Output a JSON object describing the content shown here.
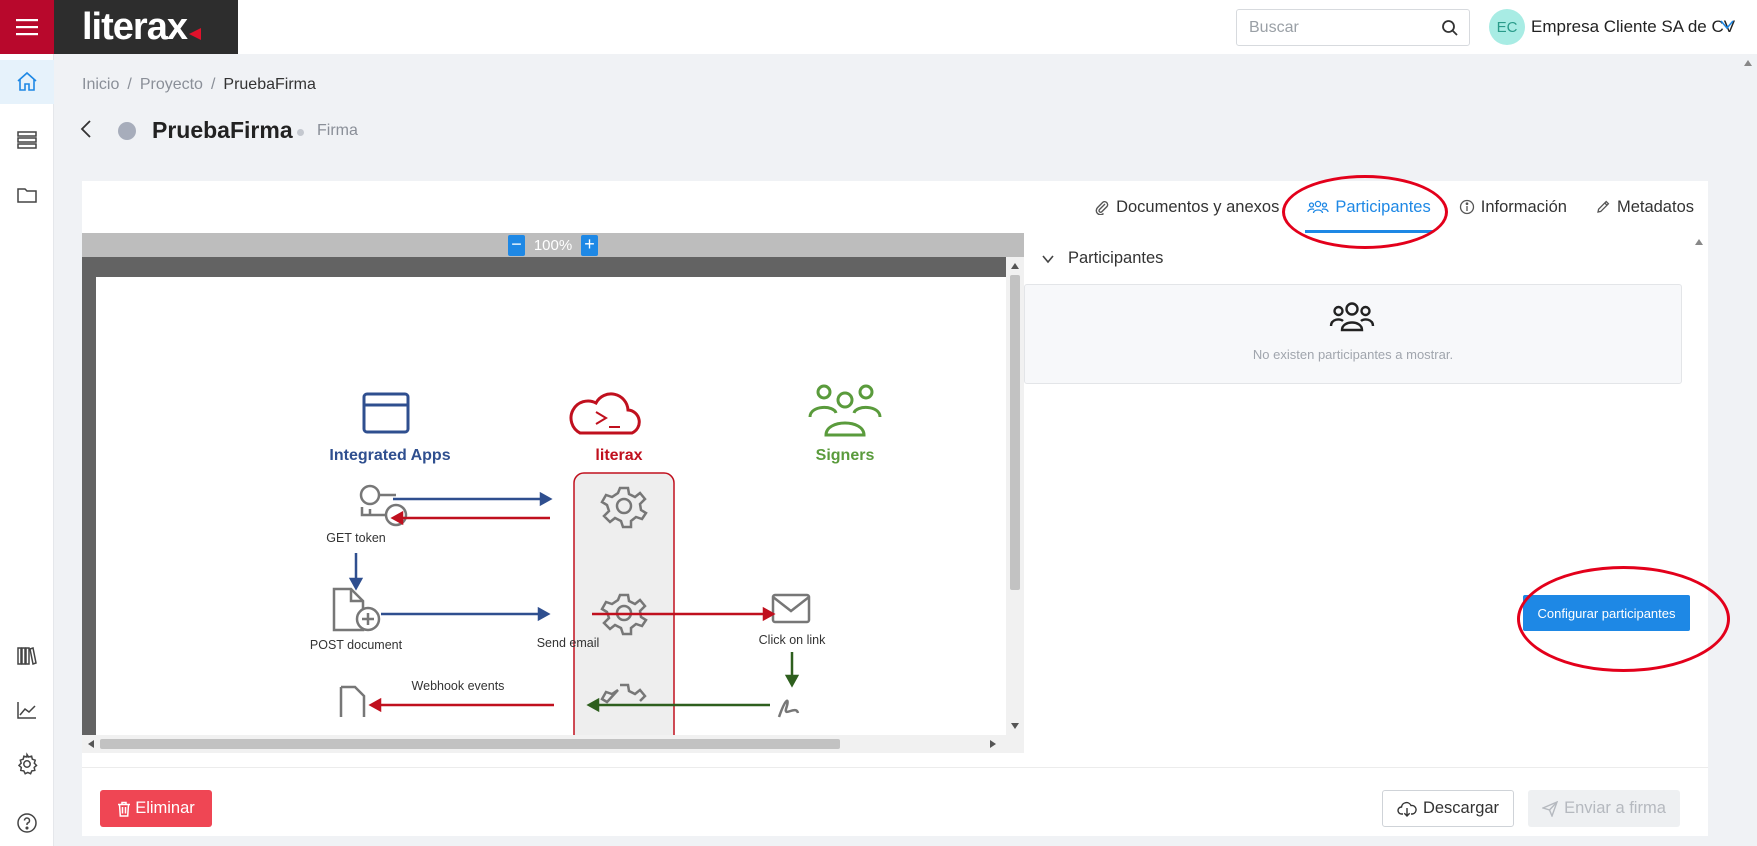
{
  "app": {
    "logo": "literax"
  },
  "header": {
    "search_placeholder": "Buscar",
    "user_initials": "EC",
    "user_name": "Empresa Cliente SA de CV"
  },
  "breadcrumb": {
    "items": [
      "Inicio",
      "Proyecto"
    ],
    "current": "PruebaFirma"
  },
  "title": {
    "name": "PruebaFirma",
    "type": "Firma"
  },
  "tabs": [
    "Documentos y anexos",
    "Participantes",
    "Información",
    "Metadatos"
  ],
  "active_tab": "Participantes",
  "viewer": {
    "zoom": "100%",
    "diagram": {
      "col_apps": "Integrated Apps",
      "col_literax": "literax",
      "col_signers": "Signers",
      "step_get_token": "GET token",
      "step_post_document": "POST document",
      "step_send_email": "Send email",
      "step_click_link": "Click on link",
      "step_webhook": "Webhook events"
    }
  },
  "participants": {
    "section_title": "Participantes",
    "empty_text": "No existen participantes a mostrar.",
    "config_button": "Configurar participantes"
  },
  "footer": {
    "delete_label": "Eliminar",
    "download_label": "Descargar",
    "send_label": "Enviar a firma"
  },
  "colors": {
    "brand_red": "#b8082c",
    "accent_blue": "#1e88e5",
    "danger": "#ef4654",
    "diagram_blue": "#2f4f8f",
    "diagram_red": "#c0101e",
    "diagram_green": "#5a9b3c"
  }
}
